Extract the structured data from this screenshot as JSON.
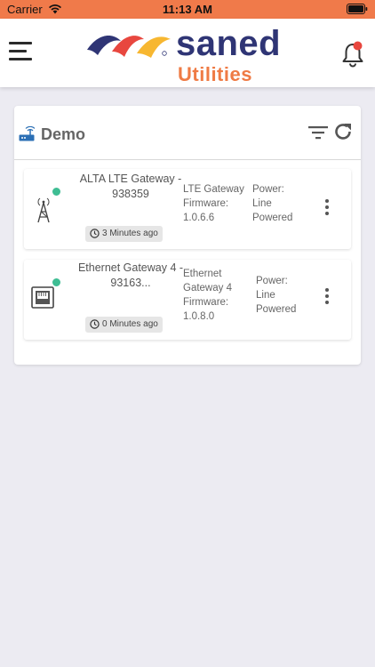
{
  "status_bar": {
    "carrier": "Carrier",
    "time": "11:13 AM"
  },
  "header": {
    "brand_name": "saned",
    "brand_sub": "Utilities",
    "notification_dot_color": "#e8473f"
  },
  "colors": {
    "accent": "#ef7b45",
    "brand_navy": "#2f3575",
    "status_online": "#3ebd93"
  },
  "site": {
    "title": "Demo"
  },
  "devices": [
    {
      "name": "ALTA LTE Gateway - 938359",
      "type_line1": "LTE Gateway",
      "type_line2": "Firmware:",
      "type_line3": "1.0.6.6",
      "power_line1": "Power:",
      "power_line2": "Line",
      "power_line3": "Powered",
      "last_seen": "3 Minutes ago",
      "icon": "cell-tower-icon",
      "status": "online"
    },
    {
      "name": "Ethernet Gateway 4 - 93163...",
      "type_line1": "Ethernet",
      "type_line2": "Gateway 4",
      "type_line3": "Firmware:",
      "type_line4": "1.0.8.0",
      "power_line1": "Power:",
      "power_line2": "Line",
      "power_line3": "Powered",
      "last_seen": "0 Minutes ago",
      "icon": "ethernet-port-icon",
      "status": "online"
    }
  ]
}
